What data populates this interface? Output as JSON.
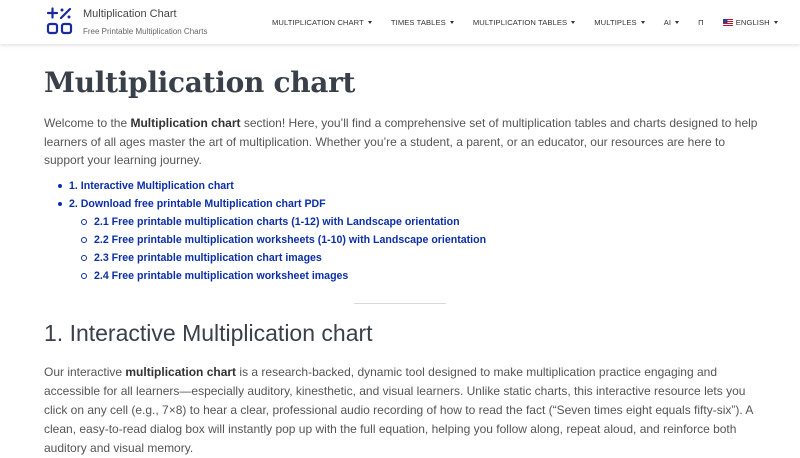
{
  "brand": {
    "title": "Multiplication Chart",
    "subtitle": "Free Printable Multiplication Charts",
    "logo_icon": "percent-grid-logo-icon",
    "logo_color": "#1a2a9c"
  },
  "nav": {
    "items": [
      {
        "label": "MULTIPLICATION CHART",
        "has_dropdown": true
      },
      {
        "label": "TIMES TABLES",
        "has_dropdown": true
      },
      {
        "label": "MULTIPLICATION TABLES",
        "has_dropdown": true
      },
      {
        "label": "MULTIPLES",
        "has_dropdown": true
      },
      {
        "label": "AI",
        "has_dropdown": true
      },
      {
        "label": "Π",
        "has_dropdown": false
      },
      {
        "label": "ENGLISH",
        "has_dropdown": true,
        "icon": "us-flag-icon"
      }
    ]
  },
  "main": {
    "title": "Multiplication chart",
    "intro": {
      "before": "Welcome to the ",
      "bold": "Multiplication chart",
      "after": " section! Here, you’ll find a comprehensive set of multiplication tables and charts designed to help learners of all ages master the art of multiplication. Whether you’re a student, a parent, or an educator, our resources are here to support your learning journey."
    },
    "toc": [
      {
        "label": "1. Interactive Multiplication chart",
        "level": 1
      },
      {
        "label": "2. Download free printable Multiplication chart PDF",
        "level": 1
      },
      {
        "label": "2.1 Free printable multiplication charts (1-12) with Landscape orientation",
        "level": 2
      },
      {
        "label": "2.2 Free printable multiplication worksheets (1-10) with Landscape orientation",
        "level": 2
      },
      {
        "label": "2.3 Free printable multiplication chart images",
        "level": 2
      },
      {
        "label": "2.4 Free printable multiplication worksheet images",
        "level": 2
      }
    ],
    "section1": {
      "title": "1. Interactive Multiplication chart",
      "body": {
        "before": "Our interactive ",
        "bold": "multiplication chart",
        "after": " is a research-backed, dynamic tool designed to make multiplication practice engaging and accessible for all learners—especially auditory, kinesthetic, and visual learners. Unlike static charts, this interactive resource lets you click on any cell (e.g., 7×8) to hear a clear, professional audio recording of how to read the fact (“Seven times eight equals fifty-six”). A clean, easy-to-read dialog box will instantly pop up with the full equation, helping you follow along, repeat aloud, and reinforce both auditory and visual memory."
      }
    }
  },
  "colors": {
    "link": "#0b2fa6",
    "heading": "#3a4049",
    "text": "#555555"
  }
}
